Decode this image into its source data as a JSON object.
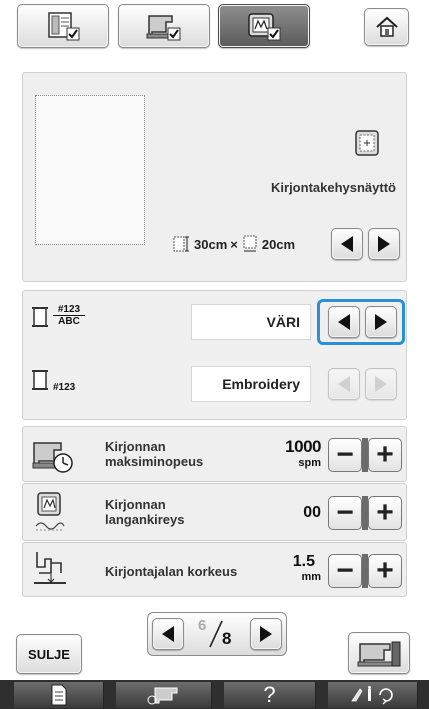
{
  "top_bar": {
    "tab1_icon": "machine-settings-icon",
    "tab2_icon": "sewing-settings-icon",
    "tab3_icon": "embroidery-settings-icon",
    "home_icon": "home-icon"
  },
  "frame_display": {
    "title": "Kirjontakehysnäyttö",
    "size_width": "30cm",
    "size_times": "×",
    "size_height": "20cm"
  },
  "thread_color": {
    "value": "VÄRI",
    "icon_top": "#123",
    "icon_bottom": "ABC"
  },
  "thread_number": {
    "value": "Embroidery",
    "icon_text": "#123"
  },
  "max_speed": {
    "label_line1": "Kirjonnan",
    "label_line2": "maksiminopeus",
    "value": "1000",
    "unit": "spm"
  },
  "tension": {
    "label_line1": "Kirjonnan",
    "label_line2": "langankireys",
    "value": "00"
  },
  "foot_height": {
    "label": "Kirjontajalan korkeus",
    "value": "1.5",
    "unit": "mm"
  },
  "pager": {
    "current": "6",
    "total": "8"
  },
  "bottom": {
    "close_label": "SULJE",
    "help_label": "?"
  },
  "colors": {
    "selected_border": "#2b8fd6",
    "panel_bg": "#efefef",
    "bottom_bar": "#2f2f2f"
  }
}
